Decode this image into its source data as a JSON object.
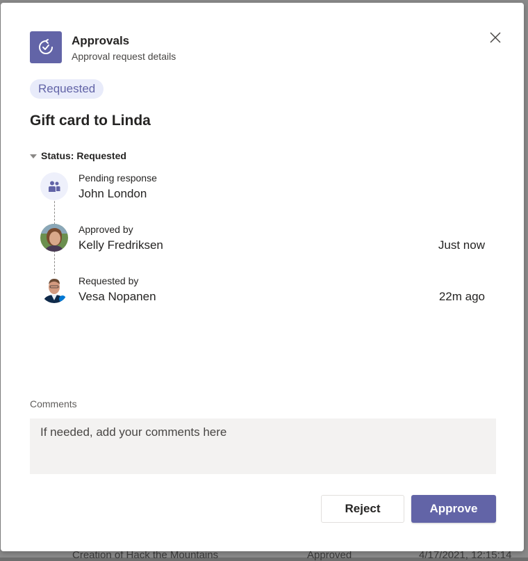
{
  "background": {
    "row_text": "Creation of Hack the Mountains",
    "row_status": "Approved",
    "row_date": "4/17/2021, 12:15:14"
  },
  "header": {
    "app_title": "Approvals",
    "subtitle": "Approval request details",
    "app_icon": "approvals-icon",
    "close_icon": "close-icon"
  },
  "request": {
    "status_pill": "Requested",
    "title": "Gift card to Linda",
    "status_toggle_label": "Status: Requested"
  },
  "timeline": [
    {
      "label": "Pending response",
      "name": "John London",
      "time": "",
      "avatar": "team-icon"
    },
    {
      "label": "Approved by",
      "name": "Kelly Fredriksen",
      "time": "Just now",
      "avatar": "avatar-kelly"
    },
    {
      "label": "Requested by",
      "name": "Vesa Nopanen",
      "time": "22m ago",
      "avatar": "avatar-vesa"
    }
  ],
  "comments": {
    "label": "Comments",
    "placeholder": "If needed, add your comments here",
    "value": ""
  },
  "actions": {
    "reject_label": "Reject",
    "approve_label": "Approve"
  },
  "colors": {
    "brand": "#6264a7",
    "pill_bg": "#e8ebfa",
    "input_bg": "#f3f2f1"
  }
}
